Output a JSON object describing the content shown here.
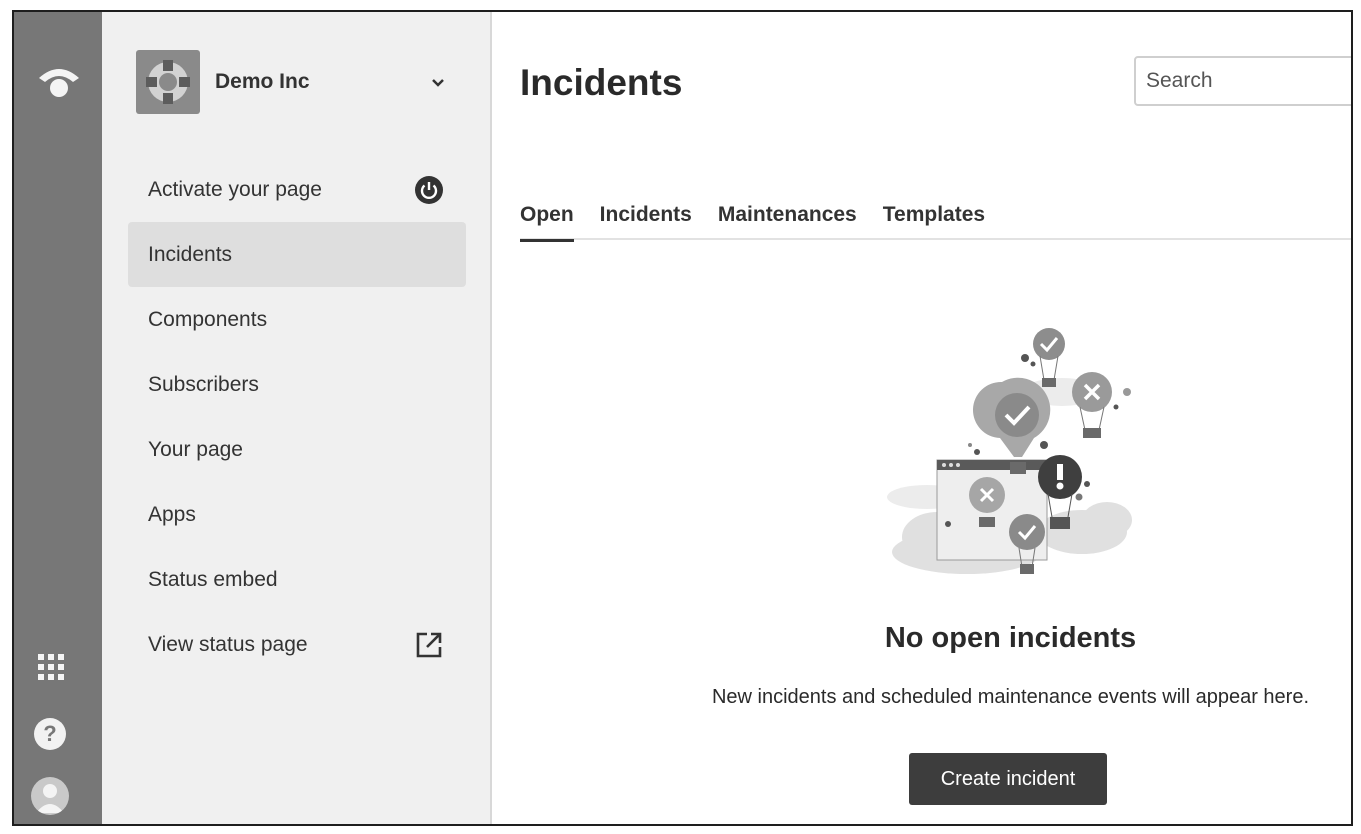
{
  "rail": {
    "logo_icon": "statuspage-logo-icon",
    "apps_icon": "app-switcher-icon",
    "help_glyph": "?",
    "help_icon": "help-icon",
    "avatar_icon": "user-avatar-icon"
  },
  "org": {
    "name": "Demo Inc",
    "logo_icon": "life-ring-icon",
    "chevron_icon": "chevron-down-icon"
  },
  "sidebar": {
    "items": [
      {
        "label": "Activate your page",
        "icon": "power-icon"
      },
      {
        "label": "Incidents",
        "active": true
      },
      {
        "label": "Components"
      },
      {
        "label": "Subscribers"
      },
      {
        "label": "Your page"
      },
      {
        "label": "Apps"
      },
      {
        "label": "Status embed"
      },
      {
        "label": "View status page",
        "icon": "external-link-icon"
      }
    ]
  },
  "main": {
    "title": "Incidents",
    "search": {
      "placeholder": "Search",
      "value": ""
    },
    "tabs": [
      {
        "label": "Open",
        "active": true
      },
      {
        "label": "Incidents"
      },
      {
        "label": "Maintenances"
      },
      {
        "label": "Templates"
      }
    ],
    "empty_state": {
      "illustration": "hot-air-balloons-illustration",
      "title": "No open incidents",
      "description": "New incidents and scheduled maintenance events will appear here.",
      "button_label": "Create incident"
    }
  },
  "colors": {
    "rail": "#777777",
    "sidebar": "#f0f0f0",
    "active_item": "#dedede",
    "button": "#3d3d3d"
  }
}
